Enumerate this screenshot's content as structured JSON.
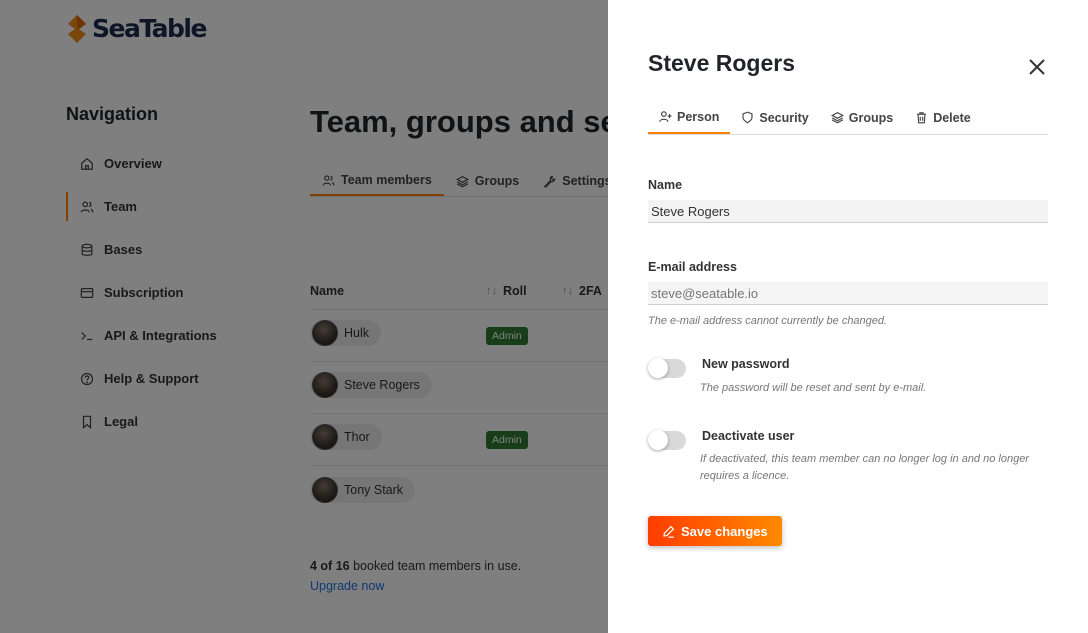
{
  "app": {
    "logo_text": "SeaTable"
  },
  "navigation": {
    "title": "Navigation",
    "items": [
      {
        "label": "Overview",
        "icon": "home-icon"
      },
      {
        "label": "Team",
        "icon": "users-icon",
        "active": true
      },
      {
        "label": "Bases",
        "icon": "database-icon"
      },
      {
        "label": "Subscription",
        "icon": "credit-card-icon"
      },
      {
        "label": "API & Integrations",
        "icon": "terminal-icon"
      },
      {
        "label": "Help & Support",
        "icon": "help-circle-icon"
      },
      {
        "label": "Legal",
        "icon": "bookmark-icon"
      }
    ]
  },
  "page": {
    "title": "Team, groups and set",
    "tabs": [
      {
        "label": "Team members",
        "icon": "users-icon",
        "active": true
      },
      {
        "label": "Groups",
        "icon": "layers-icon"
      },
      {
        "label": "Settings",
        "icon": "wrench-icon"
      }
    ]
  },
  "team_table": {
    "columns": {
      "name": "Name",
      "roll": "Roll",
      "twofa": "2FA"
    },
    "rows": [
      {
        "name": "Hulk",
        "roll": "Admin"
      },
      {
        "name": "Steve Rogers",
        "roll": ""
      },
      {
        "name": "Thor",
        "roll": "Admin"
      },
      {
        "name": "Tony Stark",
        "roll": ""
      }
    ]
  },
  "usage": {
    "count_bold": "4 of 16",
    "count_rest": " booked team members in use.",
    "upgrade_link": "Upgrade now"
  },
  "drawer": {
    "title": "Steve Rogers",
    "tabs": [
      {
        "label": "Person",
        "icon": "user-plus-icon",
        "active": true
      },
      {
        "label": "Security",
        "icon": "shield-icon"
      },
      {
        "label": "Groups",
        "icon": "layers-icon"
      },
      {
        "label": "Delete",
        "icon": "trash-icon"
      }
    ],
    "name_label": "Name",
    "name_value": "Steve Rogers",
    "email_label": "E-mail address",
    "email_placeholder": "steve@seatable.io",
    "email_hint": "The e-mail address cannot currently be changed.",
    "new_password_label": "New password",
    "new_password_hint": "The password will be reset and sent by e-mail.",
    "new_password_on": false,
    "deactivate_label": "Deactivate user",
    "deactivate_hint_line1": "If deactivated, this team member can no longer log in and no longer",
    "deactivate_hint_line2": "requires a licence.",
    "deactivate_on": false,
    "save_label": "Save changes"
  },
  "colors": {
    "accent": "#ff8000",
    "admin_badge": "#2e7d32",
    "link": "#1a73e8",
    "save_gradient_start": "#ff3c00",
    "save_gradient_end": "#ff8a00"
  }
}
